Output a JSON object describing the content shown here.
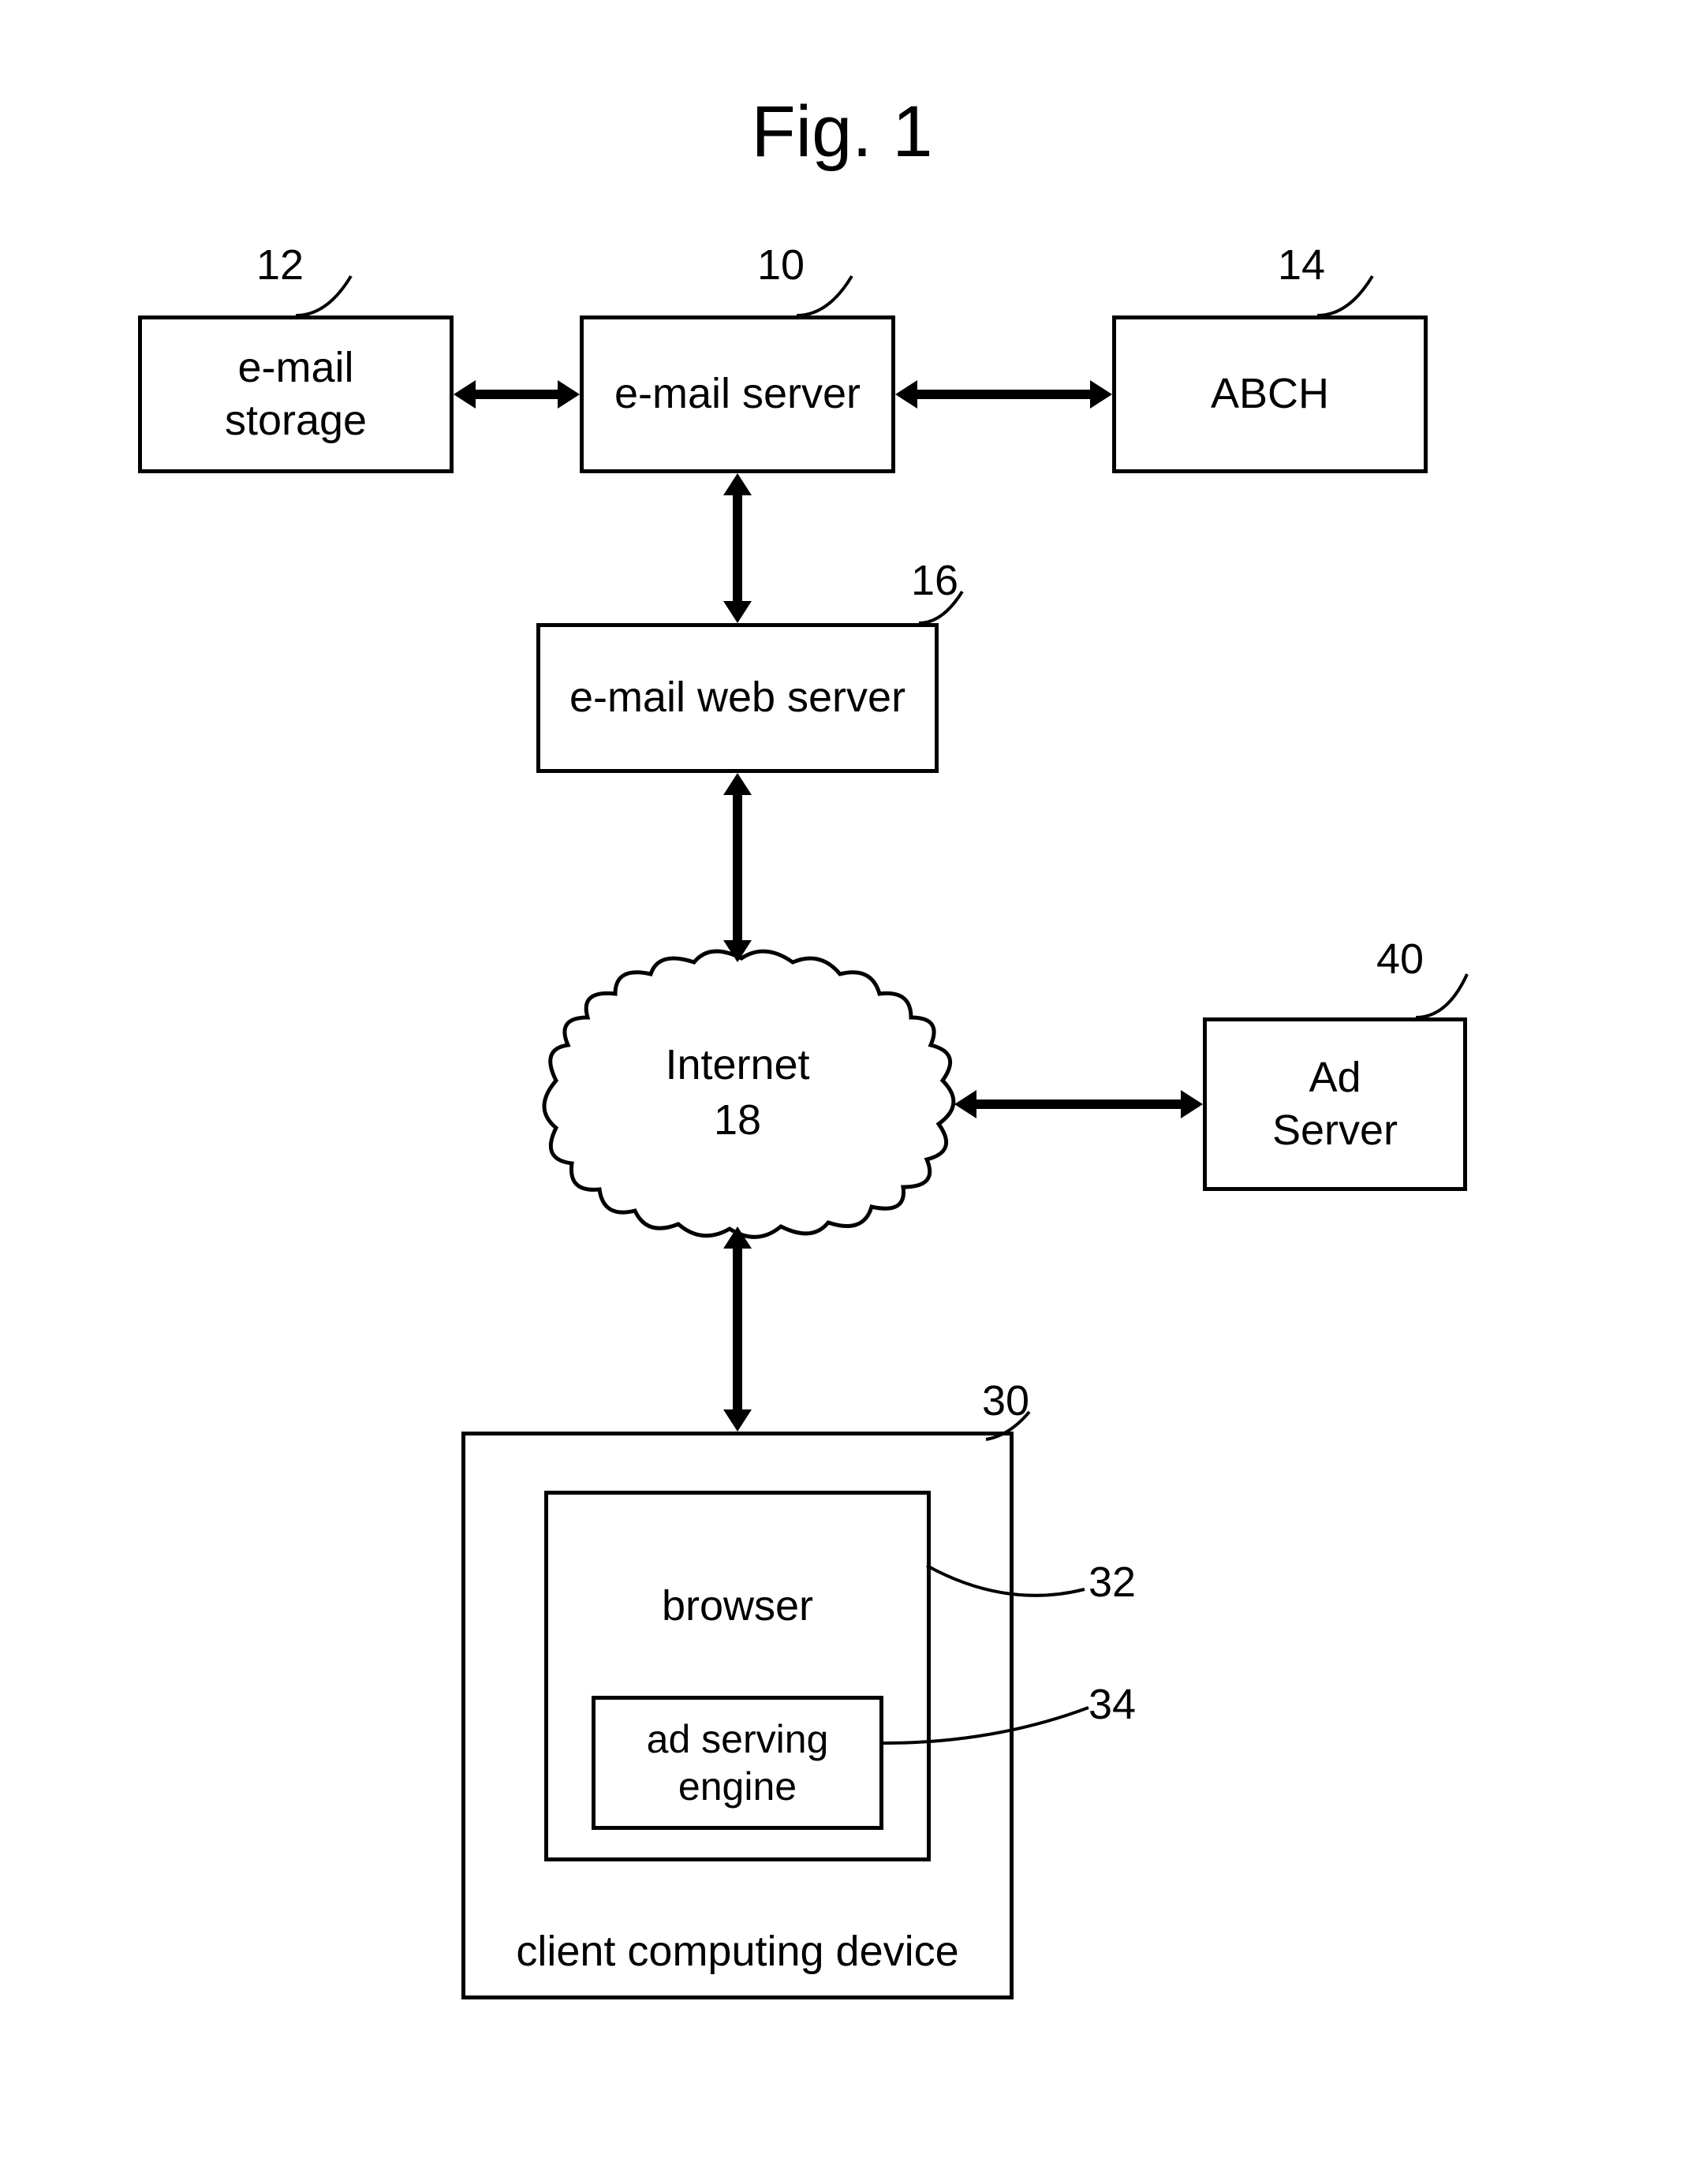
{
  "figure": {
    "title": "Fig. 1"
  },
  "nodes": {
    "email_storage": {
      "label": "e-mail\nstorage",
      "ref": "12"
    },
    "email_server": {
      "label": "e-mail server",
      "ref": "10"
    },
    "abch": {
      "label": "ABCH",
      "ref": "14"
    },
    "email_web_server": {
      "label": "e-mail web server",
      "ref": "16"
    },
    "internet": {
      "label": "Internet\n18"
    },
    "ad_server": {
      "label": "Ad\nServer",
      "ref": "40"
    },
    "client_device": {
      "label": "client computing device",
      "ref": "30"
    },
    "browser": {
      "label": "browser",
      "ref": "32"
    },
    "ad_engine": {
      "label": "ad serving\nengine",
      "ref": "34"
    }
  }
}
